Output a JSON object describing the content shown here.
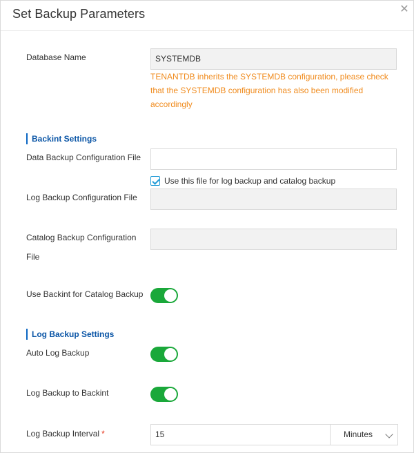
{
  "dialog": {
    "title": "Set Backup Parameters",
    "close_icon": "close-icon"
  },
  "database": {
    "label": "Database Name",
    "value": "SYSTEMDB",
    "hint": "TENANTDB inherits the SYSTEMDB configuration, please check that the SYSTEMDB configuration has also been modified accordingly"
  },
  "backint": {
    "section_title": "Backint Settings",
    "data_file_label": "Data Backup Configuration File",
    "data_file_value": "",
    "checkbox_label": "Use this file for log backup and catalog backup",
    "checkbox_checked": true,
    "log_file_label": "Log Backup Configuration File",
    "log_file_value": "",
    "catalog_file_label_line1": "Catalog Backup Configuration",
    "catalog_file_label_line2": "File",
    "catalog_file_value": "",
    "use_backint_label": "Use Backint for Catalog Backup",
    "use_backint_on": true
  },
  "log_backup": {
    "section_title": "Log Backup Settings",
    "auto_label": "Auto Log Backup",
    "auto_on": true,
    "to_backint_label": "Log Backup to Backint",
    "to_backint_on": true,
    "interval_label": "Log Backup Interval",
    "required_mark": "*",
    "interval_value": "15",
    "interval_unit": "Minutes"
  },
  "colors": {
    "accent_green": "#1aa83a",
    "hint_orange": "#f08b1d",
    "section_blue": "#0a55a6"
  }
}
